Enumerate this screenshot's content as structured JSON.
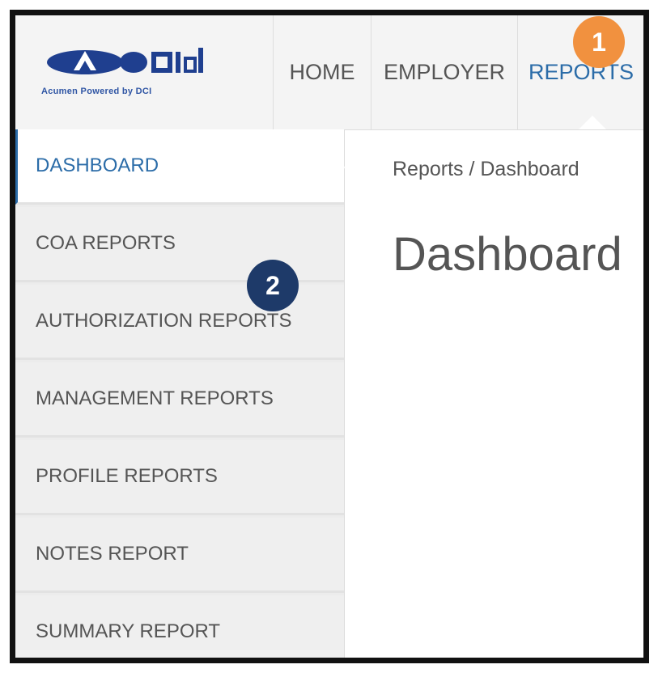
{
  "logo": {
    "caption": "Acumen Powered by DCI"
  },
  "nav": {
    "items": [
      {
        "label": "HOME"
      },
      {
        "label": "EMPLOYER"
      },
      {
        "label": "REPORTS"
      }
    ],
    "active": "REPORTS"
  },
  "sidebar": {
    "items": [
      {
        "label": "DASHBOARD"
      },
      {
        "label": "COA REPORTS"
      },
      {
        "label": "AUTHORIZATION REPORTS"
      },
      {
        "label": "MANAGEMENT REPORTS"
      },
      {
        "label": "PROFILE REPORTS"
      },
      {
        "label": "NOTES REPORT"
      },
      {
        "label": "SUMMARY REPORT"
      }
    ],
    "active": "DASHBOARD"
  },
  "main": {
    "breadcrumb": "Reports / Dashboard",
    "title": "Dashboard"
  },
  "annotations": {
    "step1": "1",
    "step2": "2"
  },
  "colors": {
    "accent_blue": "#2b6ca8",
    "logo_blue": "#2f55a4",
    "badge_orange": "#f1913f",
    "badge_navy": "#1e3a69"
  }
}
